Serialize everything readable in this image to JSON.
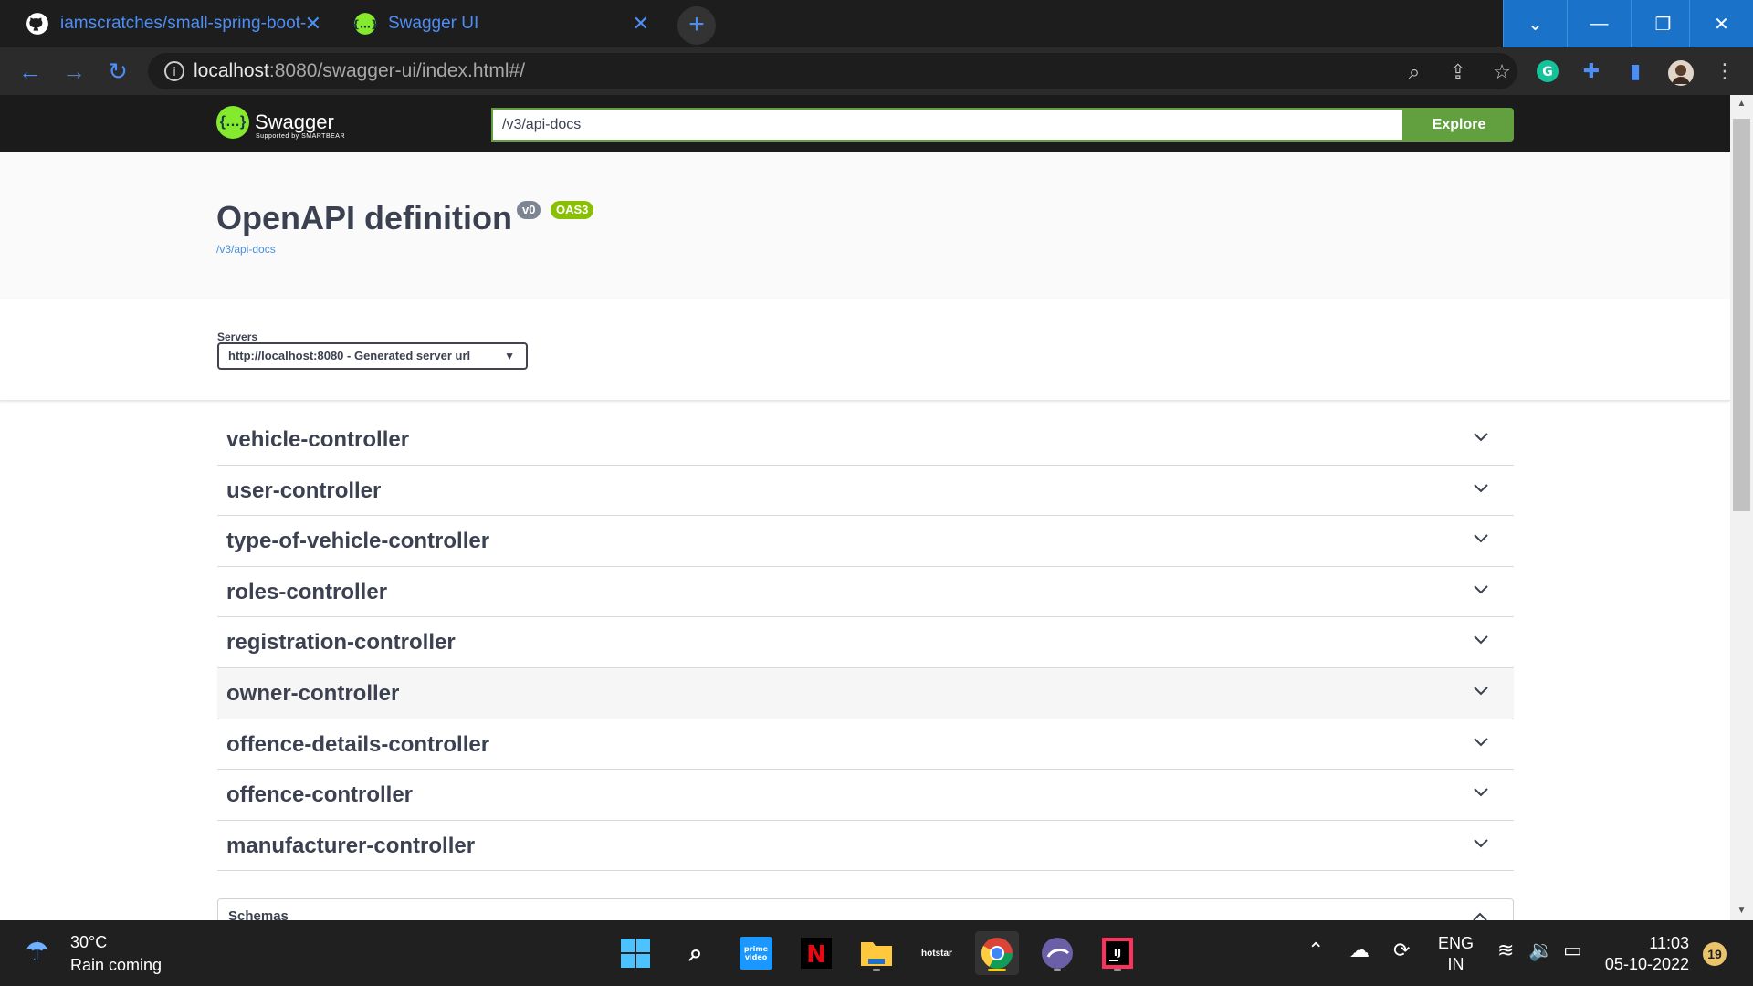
{
  "browser": {
    "tabs": [
      {
        "title": "iamscratches/small-spring-boot-",
        "icon": "github-icon",
        "active": false
      },
      {
        "title": "Swagger UI",
        "icon": "swagger-icon",
        "active": true
      }
    ],
    "new_tab_label": "+",
    "url_host": "localhost",
    "url_rest": ":8080/swagger-ui/index.html#/",
    "window_controls": [
      "chevron-down",
      "minimize",
      "restore",
      "close"
    ]
  },
  "swagger": {
    "logo_text": "Swagger",
    "logo_sub": "Supported by SMARTBEAR",
    "spec_url": "/v3/api-docs",
    "explore_label": "Explore",
    "title": "OpenAPI definition",
    "version_badge": "v0",
    "oas_badge": "OAS3",
    "api_link": "/v3/api-docs",
    "servers_label": "Servers",
    "server_selected": "http://localhost:8080 - Generated server url",
    "controllers": [
      "vehicle-controller",
      "user-controller",
      "type-of-vehicle-controller",
      "roles-controller",
      "registration-controller",
      "owner-controller",
      "offence-details-controller",
      "offence-controller",
      "manufacturer-controller"
    ],
    "schemas_label": "Schemas",
    "colors": {
      "accent": "#62a03f",
      "badge_oas": "#89bf04",
      "badge_version": "#7d8492",
      "link": "#4990e2"
    }
  },
  "taskbar": {
    "weather_temp": "30°C",
    "weather_desc": "Rain coming",
    "lang_line1": "ENG",
    "lang_line2": "IN",
    "time": "11:03",
    "date": "05-10-2022",
    "notifications": "19",
    "apps": [
      "start",
      "search",
      "prime-video",
      "netflix",
      "file-explorer",
      "disney-hotstar",
      "chrome",
      "browser",
      "intellij"
    ]
  }
}
